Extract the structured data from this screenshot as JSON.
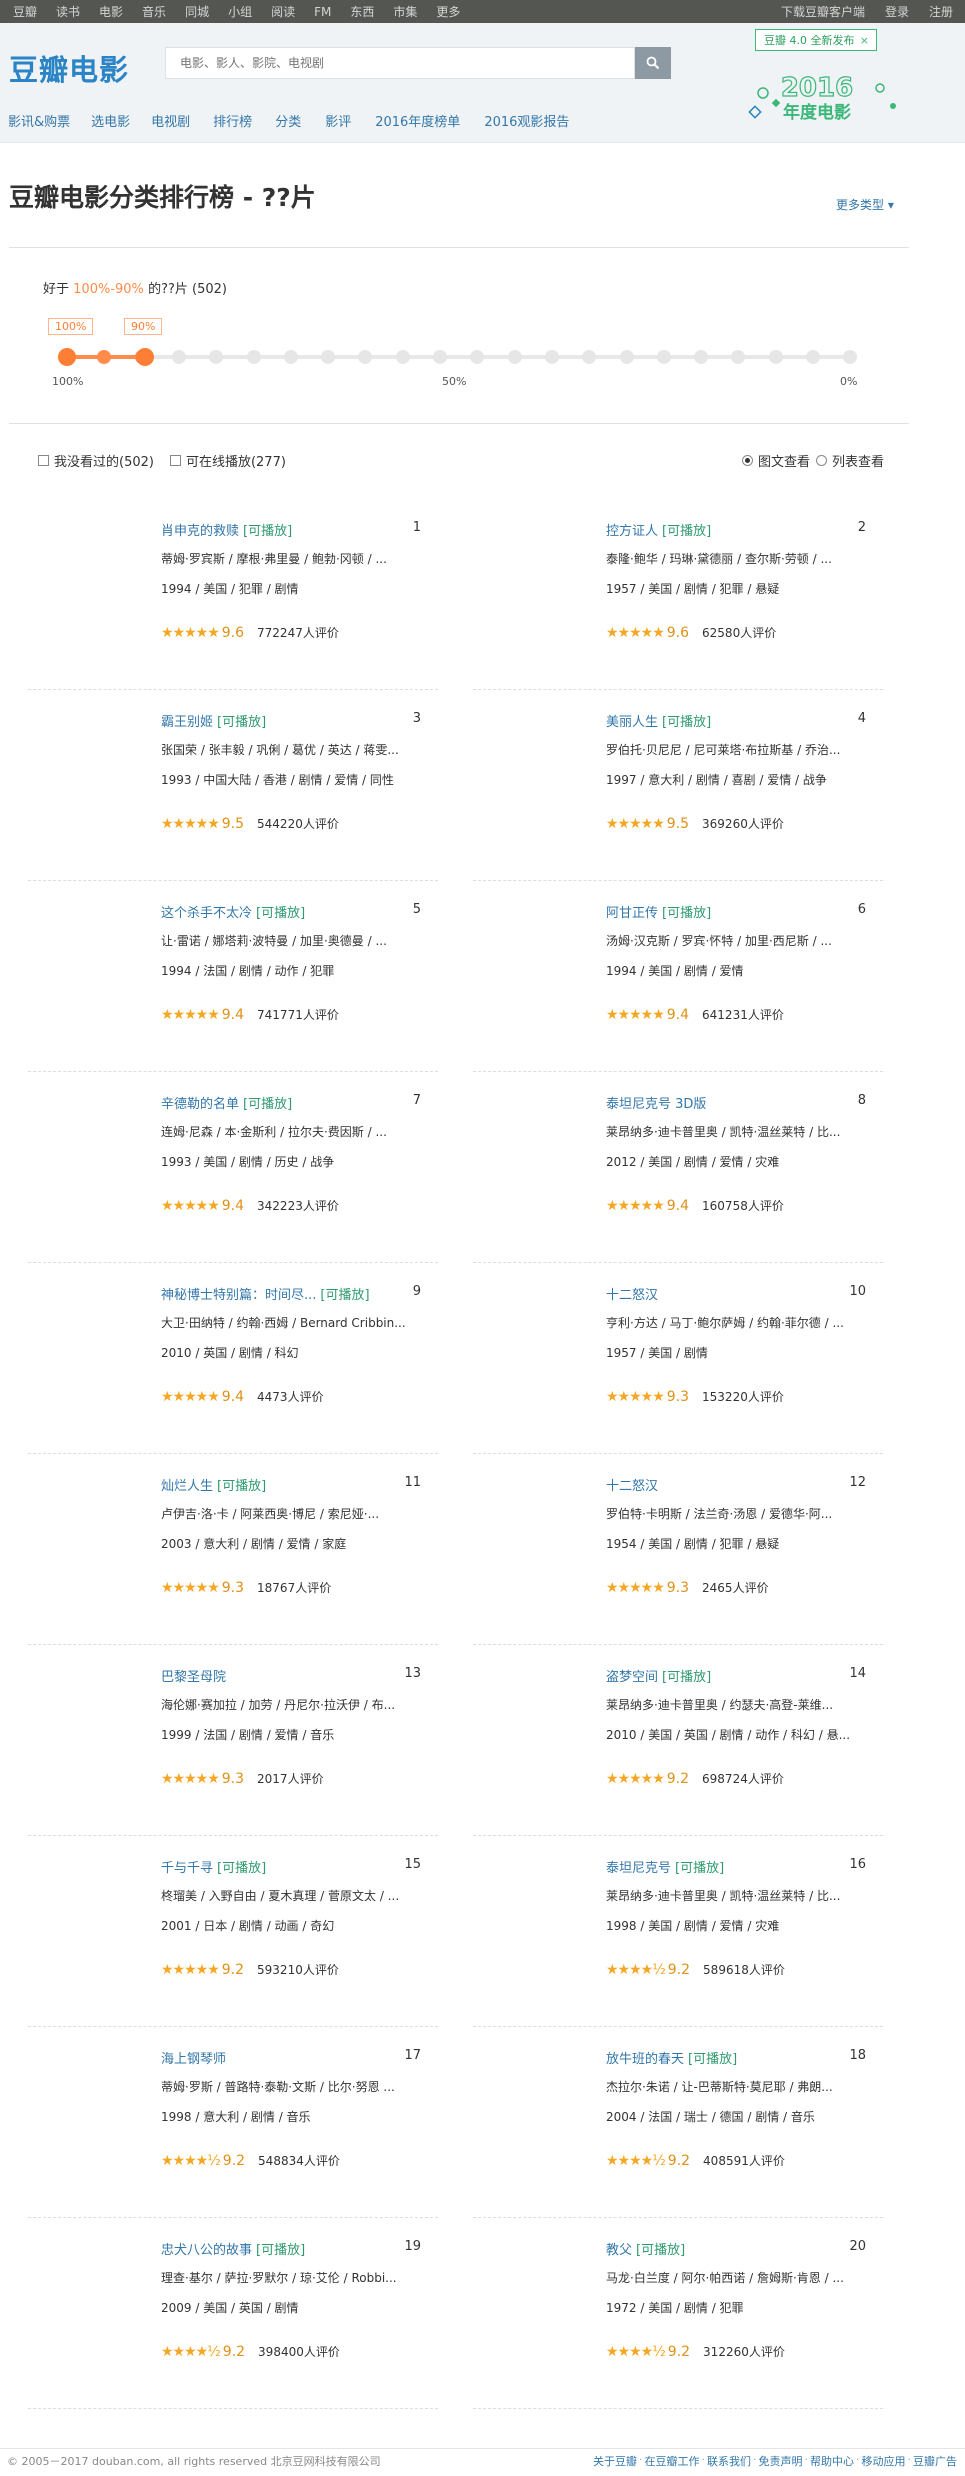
{
  "global_nav": {
    "links": [
      "豆瓣",
      "读书",
      "电影",
      "音乐",
      "同城",
      "小组",
      "阅读",
      "FM",
      "东西",
      "市集",
      "更多"
    ],
    "right": [
      "下载豆瓣客户端",
      "登录",
      "注册"
    ]
  },
  "header": {
    "logo": "豆瓣电影",
    "search_placeholder": "电影、影人、影院、电视剧",
    "subnav": [
      "影讯&购票",
      "选电影",
      "电视剧",
      "排行榜",
      "分类",
      "影评",
      "2016年度榜单",
      "2016观影报告"
    ],
    "promo_badge": "豆瓣 4.0 全新发布",
    "promo_close": "×",
    "promo_art_title": "2016",
    "promo_art_subtitle": "年度电影"
  },
  "page": {
    "title": "豆瓣电影分类排行榜 - ??片",
    "more_types": "更多类型 ▾",
    "range_prefix": "好于",
    "range_value": "100%-90%",
    "range_suffix": "的??片 (502)",
    "tag_left": "100%",
    "tag_right": "90%",
    "scale_left": "100%",
    "scale_mid": "50%",
    "scale_right": "0%",
    "filter_unwatched": "我没看过的(502)",
    "filter_online": "可在线播放(277)",
    "view_card": "图文查看",
    "view_list": "列表查看"
  },
  "movies": [
    {
      "rank": "1",
      "title": "肖申克的救赎",
      "playable": "[可播放]",
      "cast": "蒂姆·罗宾斯 / 摩根·弗里曼 / 鲍勃·冈顿 / ...",
      "meta": "1994 / 美国 / 犯罪 / 剧情",
      "stars": "★★★★★",
      "score": "9.6",
      "votes": "772247人评价"
    },
    {
      "rank": "2",
      "title": "控方证人",
      "playable": "[可播放]",
      "cast": "泰隆·鲍华 / 玛琳·黛德丽 / 查尔斯·劳顿 / ...",
      "meta": "1957 / 美国 / 剧情 / 犯罪 / 悬疑",
      "stars": "★★★★★",
      "score": "9.6",
      "votes": "62580人评价"
    },
    {
      "rank": "3",
      "title": "霸王别姬",
      "playable": "[可播放]",
      "cast": "张国荣 / 张丰毅 / 巩俐 / 葛优 / 英达 / 蒋雯...",
      "meta": "1993 / 中国大陆 / 香港 / 剧情 / 爱情 / 同性",
      "stars": "★★★★★",
      "score": "9.5",
      "votes": "544220人评价"
    },
    {
      "rank": "4",
      "title": "美丽人生",
      "playable": "[可播放]",
      "cast": "罗伯托·贝尼尼 / 尼可莱塔·布拉斯基 / 乔治...",
      "meta": "1997 / 意大利 / 剧情 / 喜剧 / 爱情 / 战争",
      "stars": "★★★★★",
      "score": "9.5",
      "votes": "369260人评价"
    },
    {
      "rank": "5",
      "title": "这个杀手不太冷",
      "playable": "[可播放]",
      "cast": "让·雷诺 / 娜塔莉·波特曼 / 加里·奥德曼 / ...",
      "meta": "1994 / 法国 / 剧情 / 动作 / 犯罪",
      "stars": "★★★★★",
      "score": "9.4",
      "votes": "741771人评价"
    },
    {
      "rank": "6",
      "title": "阿甘正传",
      "playable": "[可播放]",
      "cast": "汤姆·汉克斯 / 罗宾·怀特 / 加里·西尼斯 / ...",
      "meta": "1994 / 美国 / 剧情 / 爱情",
      "stars": "★★★★★",
      "score": "9.4",
      "votes": "641231人评价"
    },
    {
      "rank": "7",
      "title": "辛德勒的名单",
      "playable": "[可播放]",
      "cast": "连姆·尼森 / 本·金斯利 / 拉尔夫·费因斯 / ...",
      "meta": "1993 / 美国 / 剧情 / 历史 / 战争",
      "stars": "★★★★★",
      "score": "9.4",
      "votes": "342223人评价"
    },
    {
      "rank": "8",
      "title": "泰坦尼克号 3D版",
      "playable": "",
      "cast": "莱昂纳多·迪卡普里奥 / 凯特·温丝莱特 / 比...",
      "meta": "2012 / 美国 / 剧情 / 爱情 / 灾难",
      "stars": "★★★★★",
      "score": "9.4",
      "votes": "160758人评价"
    },
    {
      "rank": "9",
      "title": "神秘博士特别篇：时间尽...",
      "playable": "[可播放]",
      "cast": "大卫·田纳特 / 约翰·西姆 / Bernard Cribbin...",
      "meta": "2010 / 英国 / 剧情 / 科幻",
      "stars": "★★★★★",
      "score": "9.4",
      "votes": "4473人评价"
    },
    {
      "rank": "10",
      "title": "十二怒汉",
      "playable": "",
      "cast": "亨利·方达 / 马丁·鲍尔萨姆 / 约翰·菲尔德 / ...",
      "meta": "1957 / 美国 / 剧情",
      "stars": "★★★★★",
      "score": "9.3",
      "votes": "153220人评价"
    },
    {
      "rank": "11",
      "title": "灿烂人生",
      "playable": "[可播放]",
      "cast": "卢伊吉·洛·卡 / 阿莱西奥·博尼 / 索尼娅·...",
      "meta": "2003 / 意大利 / 剧情 / 爱情 / 家庭",
      "stars": "★★★★★",
      "score": "9.3",
      "votes": "18767人评价"
    },
    {
      "rank": "12",
      "title": "十二怒汉",
      "playable": "",
      "cast": "罗伯特·卡明斯 / 法兰奇·汤恩 / 爱德华·阿...",
      "meta": "1954 / 美国 / 剧情 / 犯罪 / 悬疑",
      "stars": "★★★★★",
      "score": "9.3",
      "votes": "2465人评价"
    },
    {
      "rank": "13",
      "title": "巴黎圣母院",
      "playable": "",
      "cast": "海伦娜·赛加拉 / 加劳 / 丹尼尔·拉沃伊 / 布...",
      "meta": "1999 / 法国 / 剧情 / 爱情 / 音乐",
      "stars": "★★★★★",
      "score": "9.3",
      "votes": "2017人评价"
    },
    {
      "rank": "14",
      "title": "盗梦空间",
      "playable": "[可播放]",
      "cast": "莱昂纳多·迪卡普里奥 / 约瑟夫·高登-莱维...",
      "meta": "2010 / 美国 / 英国 / 剧情 / 动作 / 科幻 / 悬...",
      "stars": "★★★★★",
      "score": "9.2",
      "votes": "698724人评价"
    },
    {
      "rank": "15",
      "title": "千与千寻",
      "playable": "[可播放]",
      "cast": "柊瑠美 / 入野自由 / 夏木真理 / 菅原文太 / ...",
      "meta": "2001 / 日本 / 剧情 / 动画 / 奇幻",
      "stars": "★★★★★",
      "score": "9.2",
      "votes": "593210人评价"
    },
    {
      "rank": "16",
      "title": "泰坦尼克号",
      "playable": "[可播放]",
      "cast": "莱昂纳多·迪卡普里奥 / 凯特·温丝莱特 / 比...",
      "meta": "1998 / 美国 / 剧情 / 爱情 / 灾难",
      "stars": "★★★★½",
      "score": "9.2",
      "votes": "589618人评价"
    },
    {
      "rank": "17",
      "title": "海上钢琴师",
      "playable": "",
      "cast": "蒂姆·罗斯 / 普路特·泰勒·文斯 / 比尔·努恩 ...",
      "meta": "1998 / 意大利 / 剧情 / 音乐",
      "stars": "★★★★½",
      "score": "9.2",
      "votes": "548834人评价"
    },
    {
      "rank": "18",
      "title": "放牛班的春天",
      "playable": "[可播放]",
      "cast": "杰拉尔·朱诺 / 让-巴蒂斯特·莫尼耶 / 弗朗...",
      "meta": "2004 / 法国 / 瑞士 / 德国 / 剧情 / 音乐",
      "stars": "★★★★½",
      "score": "9.2",
      "votes": "408591人评价"
    },
    {
      "rank": "19",
      "title": "忠犬八公的故事",
      "playable": "[可播放]",
      "cast": "理查·基尔 / 萨拉·罗默尔 / 琼·艾伦 / Robbi...",
      "meta": "2009 / 美国 / 英国 / 剧情",
      "stars": "★★★★½",
      "score": "9.2",
      "votes": "398400人评价"
    },
    {
      "rank": "20",
      "title": "教父",
      "playable": "[可播放]",
      "cast": "马龙·白兰度 / 阿尔·帕西诺 / 詹姆斯·肯恩 / ...",
      "meta": "1972 / 美国 / 剧情 / 犯罪",
      "stars": "★★★★½",
      "score": "9.2",
      "votes": "312260人评价"
    }
  ],
  "footer": {
    "copyright": "© 2005－2017 douban.com, all rights reserved 北京豆网科技有限公司",
    "links": [
      "关于豆瓣",
      "在豆瓣工作",
      "联系我们",
      "免责声明",
      "帮助中心",
      "移动应用",
      "豆瓣广告"
    ]
  },
  "colors": {
    "brand": "#2a84c6",
    "link": "#3377aa",
    "accent_orange": "#ff8c4b",
    "star": "#f5a623",
    "playable_green": "#2f9a6f"
  }
}
